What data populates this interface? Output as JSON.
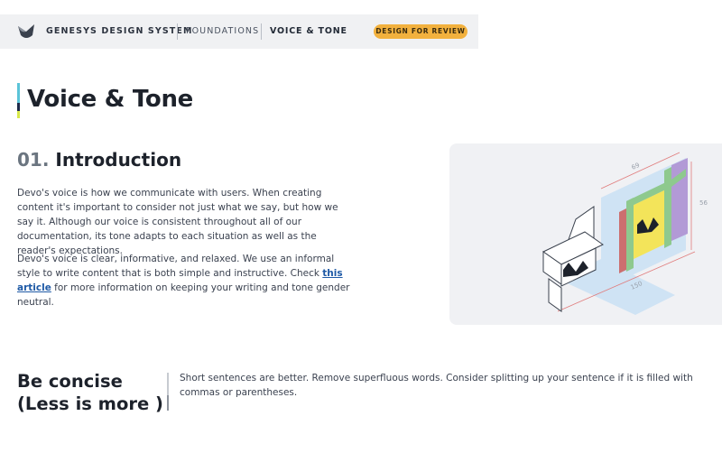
{
  "header": {
    "brand": "GENESYS DESIGN SYSTEM",
    "breadcrumbs": [
      "FOUNDATIONS",
      "VOICE & TONE"
    ],
    "badge": "DESIGN FOR REVIEW"
  },
  "page": {
    "title": "Voice & Tone"
  },
  "intro": {
    "number": "01.",
    "heading": "Introduction",
    "paragraph1": "Devo's voice is how we communicate with users. When creating content it's important to consider not just what we say, but how we say it. Although our voice is consistent throughout all of our documentation, its tone adapts to each situation as well as the reader's expectations.",
    "paragraph2_before": "Devo's voice is clear, informative, and relaxed.  We use an informal style to write content that is both simple and instructive. Check ",
    "paragraph2_link": "this article",
    "paragraph2_after": " for more information on keeping your writing and tone gender neutral."
  },
  "illustration": {
    "dim_top": "69",
    "dim_right": "56",
    "dim_bottom": "150"
  },
  "concise": {
    "heading_line1": "Be concise",
    "heading_line2": "(Less is more )",
    "body": "Short sentences are better. Remove superfluous words. Consider splitting up your sentence if it is filled with commas or parentheses."
  },
  "colors": {
    "badge": "#f2b13e",
    "accent_cyan": "#5bc4d8",
    "accent_navy": "#1e2a4a",
    "accent_lime": "#d7e84a",
    "link": "#1f5aa6"
  }
}
